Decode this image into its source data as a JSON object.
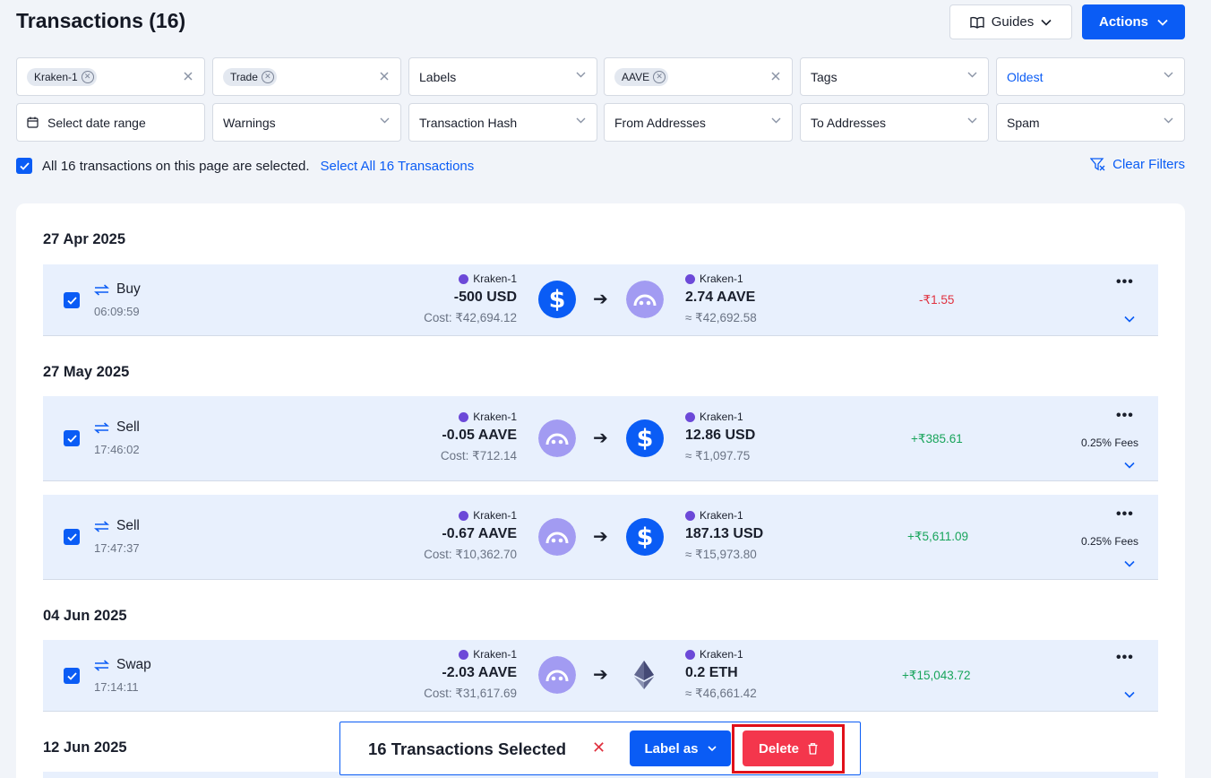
{
  "header": {
    "title": "Transactions (16)",
    "guides_label": "Guides",
    "actions_label": "Actions"
  },
  "filters": {
    "wallet_chip": "Kraken-1",
    "type_chip": "Trade",
    "labels": "Labels",
    "asset_chip": "AAVE",
    "tags": "Tags",
    "sort": "Oldest",
    "date_range": "Select date range",
    "warnings": "Warnings",
    "tx_hash": "Transaction Hash",
    "from_addresses": "From Addresses",
    "to_addresses": "To Addresses",
    "spam": "Spam"
  },
  "selection": {
    "text": "All 16 transactions on this page are selected.",
    "select_all": "Select All 16 Transactions",
    "clear_filters": "Clear Filters"
  },
  "groups": [
    {
      "date": "27 Apr 2025"
    },
    {
      "date": "27 May 2025"
    },
    {
      "date": "04 Jun 2025"
    },
    {
      "date": "12 Jun 2025"
    }
  ],
  "transactions": [
    {
      "type": "Buy",
      "time": "06:09:59",
      "from_account": "Kraken-1",
      "from_amount": "-500 USD",
      "from_sub": "Cost: ₹42,694.12",
      "from_icon": "usd-coin-icon",
      "to_account": "Kraken-1",
      "to_amount": "2.74 AAVE",
      "to_sub": "≈ ₹42,692.58",
      "to_icon": "aave-coin-icon",
      "pnl": "-₹1.55",
      "fees": ""
    },
    {
      "type": "Sell",
      "time": "17:46:02",
      "from_account": "Kraken-1",
      "from_amount": "-0.05 AAVE",
      "from_sub": "Cost: ₹712.14",
      "from_icon": "aave-coin-icon",
      "to_account": "Kraken-1",
      "to_amount": "12.86 USD",
      "to_sub": "≈ ₹1,097.75",
      "to_icon": "usd-coin-icon",
      "pnl": "+₹385.61",
      "fees": "0.25% Fees"
    },
    {
      "type": "Sell",
      "time": "17:47:37",
      "from_account": "Kraken-1",
      "from_amount": "-0.67 AAVE",
      "from_sub": "Cost: ₹10,362.70",
      "from_icon": "aave-coin-icon",
      "to_account": "Kraken-1",
      "to_amount": "187.13 USD",
      "to_sub": "≈ ₹15,973.80",
      "to_icon": "usd-coin-icon",
      "pnl": "+₹5,611.09",
      "fees": "0.25% Fees"
    },
    {
      "type": "Swap",
      "time": "17:14:11",
      "from_account": "Kraken-1",
      "from_amount": "-2.03 AAVE",
      "from_sub": "Cost: ₹31,617.69",
      "from_icon": "aave-coin-icon",
      "to_account": "Kraken-1",
      "to_amount": "0.2 ETH",
      "to_sub": "≈ ₹46,661.42",
      "to_icon": "eth-coin-icon",
      "pnl": "+₹15,043.72",
      "fees": ""
    }
  ],
  "bulk": {
    "title": "16 Transactions Selected",
    "label_as": "Label as",
    "delete": "Delete"
  },
  "colors": {
    "accent": "#0a5cf5",
    "danger": "#f4364c",
    "positive": "#18a45b",
    "negative": "#e0313f",
    "row_bg": "#e8f0fd"
  }
}
